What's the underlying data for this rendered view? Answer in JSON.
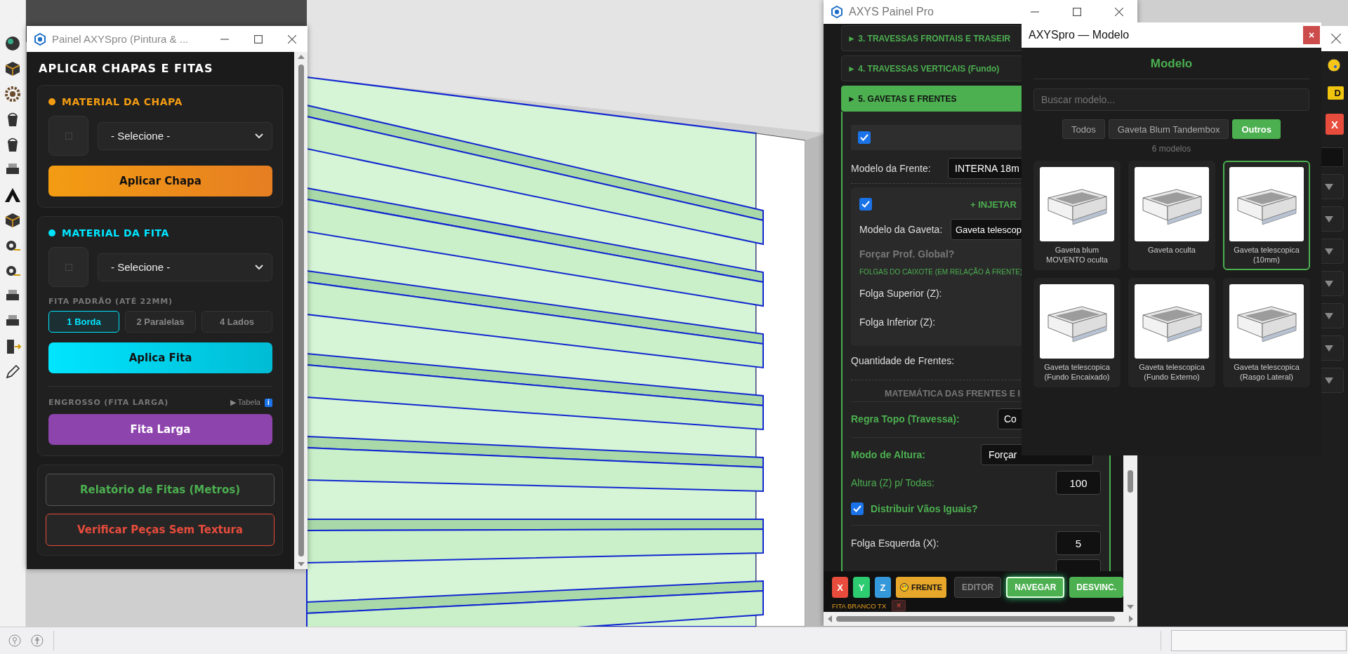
{
  "left_window": {
    "title": "Painel AXYSpro (Pintura & ...",
    "heading": "APLICAR CHAPAS E FITAS",
    "sections": [
      {
        "kind": "sheet",
        "label": "MATERIAL DA CHAPA",
        "color": "#f39c12",
        "select": "- Selecione -",
        "button": "Aplicar Chapa"
      },
      {
        "kind": "edge",
        "label": "MATERIAL DA FITA",
        "color": "#00e5ff",
        "select": "- Selecione -",
        "standard_label": "FITA PADRÃO (ATÉ 22MM)",
        "options": [
          {
            "label": "1 Borda",
            "selected": true
          },
          {
            "label": "2 Paralelas",
            "selected": false
          },
          {
            "label": "4 Lados",
            "selected": false
          }
        ],
        "button": "Aplica Fita",
        "wide_label": "ENGROSSO (FITA LARGA)",
        "table_link": "▶ Tabela",
        "info_badge": "i",
        "wide_button": "Fita Larga"
      }
    ],
    "actions": [
      {
        "kind": "report",
        "label": "Relatório de Fitas (Metros)"
      },
      {
        "kind": "warning",
        "label": "Verificar Peças Sem Textura"
      }
    ]
  },
  "main_window": {
    "title": "AXYS Painel Pro",
    "accordion": [
      {
        "label": "► 3. TRAVESSAS FRONTAIS E TRASEIR",
        "expanded": false
      },
      {
        "label": "► 4. TRAVESSAS VERTICAIS (Fundo)",
        "expanded": false
      },
      {
        "label": "► 5. GAVETAS E FRENTES",
        "expanded": true
      }
    ],
    "section": {
      "enabled": true,
      "front_model_label": "Modelo da Frente:",
      "front_model_value": "INTERNA 18m",
      "inject": {
        "checked": true,
        "title": "+ INJETAR",
        "drawer_model_label": "Modelo da Gaveta:",
        "drawer_model_value": "Gaveta telescop",
        "force_depth": "Forçar Prof. Global?",
        "clearances_title": "FOLGAS DO CAIXOTE (EM RELAÇÃO À FRENTE)",
        "fields": [
          "Folga Superior (Z):",
          "Folga Inferior (Z):"
        ]
      },
      "quantity_label": "Quantidade de Frentes:",
      "math_title": "MATEMÁTICA DAS FRENTES E I",
      "rows": [
        {
          "kind": "select",
          "label": "Regra Topo (Travessa):",
          "value": "Co"
        },
        {
          "kind": "select",
          "label": "Modo de Altura:",
          "value": "Forçar"
        },
        {
          "kind": "input",
          "label": "Altura (Z) p/ Todas:",
          "value": "100",
          "accent": true
        },
        {
          "kind": "checkbox",
          "label": "Distribuir Vãos Iguais?",
          "checked": true
        },
        {
          "kind": "input",
          "label": "Folga Esquerda (X):",
          "value": "5",
          "accent": false
        }
      ]
    },
    "toolbar": [
      {
        "kind": "axis",
        "label": "X",
        "color": "#e74c3c"
      },
      {
        "kind": "axis",
        "label": "Y",
        "color": "#2ecc71"
      },
      {
        "kind": "axis",
        "label": "Z",
        "color": "#3498db"
      },
      {
        "kind": "icon",
        "label": "FRENTE"
      },
      {
        "kind": "plain",
        "label": "EDITOR"
      },
      {
        "kind": "glow",
        "label": "NAVEGAR"
      },
      {
        "kind": "solid",
        "label": "DESVINC."
      }
    ],
    "tag": {
      "label": "FITA BRANCO TX",
      "remove": "×"
    }
  },
  "side_window": {
    "badge": "D",
    "button": "X"
  },
  "modal": {
    "title": "AXYSpro — Modelo",
    "close": "×",
    "heading": "Modelo",
    "search_placeholder": "Buscar modelo...",
    "filters": [
      {
        "label": "Todos",
        "selected": false
      },
      {
        "label": "Gaveta Blum Tandembox",
        "selected": false
      },
      {
        "label": "Outros",
        "selected": true
      }
    ],
    "count": "6 modelos",
    "models": [
      {
        "name": "Gaveta blum MOVENTO oculta",
        "selected": false
      },
      {
        "name": "Gaveta oculta",
        "selected": false
      },
      {
        "name": "Gaveta telescopica (10mm)",
        "selected": true
      },
      {
        "name": "Gaveta telescopica (Fundo Encaixado)",
        "selected": false
      },
      {
        "name": "Gaveta telescopica (Fundo Externo)",
        "selected": false
      },
      {
        "name": "Gaveta telescopica (Rasgo Lateral)",
        "selected": false
      }
    ]
  }
}
